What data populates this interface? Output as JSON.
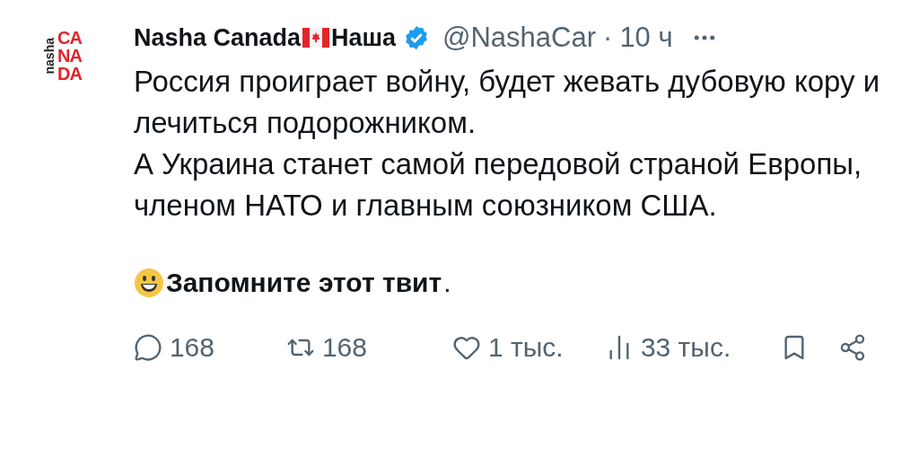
{
  "logo": {
    "vertical": "nasha",
    "rows": [
      "CA",
      "NA",
      "DA"
    ]
  },
  "author": {
    "name": "Nasha Canada",
    "name_after_flag": "Наша",
    "verified": true,
    "handle": "@NashaCar",
    "separator": "·",
    "time": "10 ч"
  },
  "body": [
    "Россия проиграет войну, будет жевать дубовую кору и лечиться подорожником.",
    "А Украина станет самой передовой страной Европы, членом НАТО и главным союзником США."
  ],
  "closing": "Запомните этот твит",
  "closing_end": ".",
  "actions": [
    {
      "kind": "reply",
      "count": "168"
    },
    {
      "kind": "repost",
      "count": "168"
    },
    {
      "kind": "like",
      "count": "1 тыс."
    },
    {
      "kind": "views",
      "count": "33 тыс."
    },
    {
      "kind": "bookmark"
    },
    {
      "kind": "share"
    }
  ]
}
